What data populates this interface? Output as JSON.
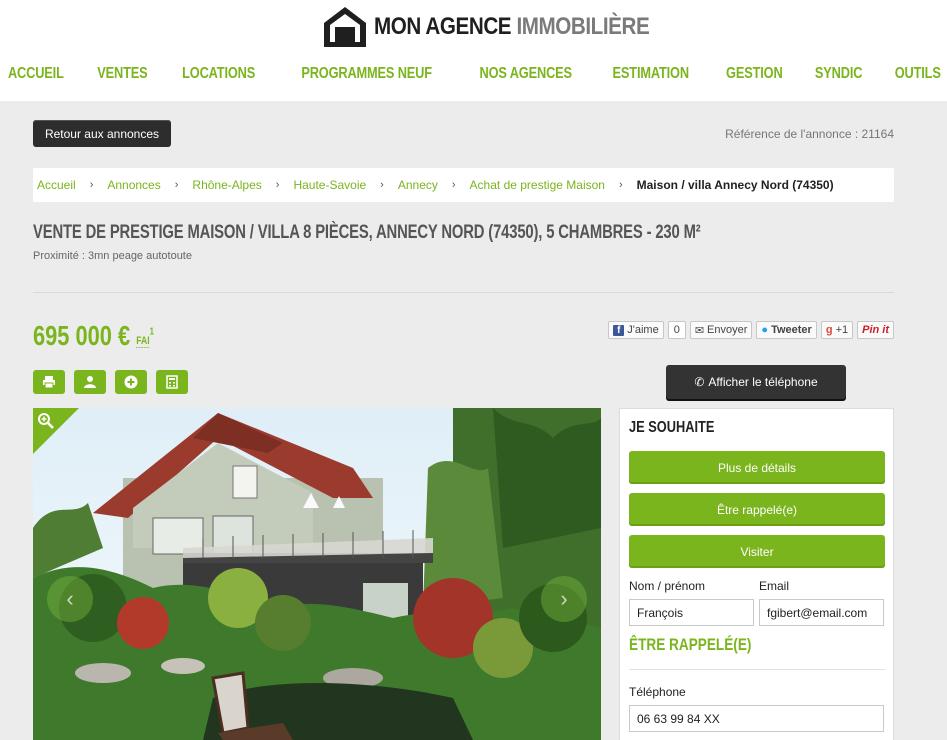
{
  "brand": {
    "name_part1": "MON AGENCE",
    "name_part2": "IMMOBILIÈRE",
    "accent_color": "#7ab51d"
  },
  "nav": [
    "ACCUEIL",
    "VENTES",
    "LOCATIONS",
    "PROGRAMMES NEUF",
    "NOS AGENCES",
    "ESTIMATION",
    "GESTION",
    "SYNDIC",
    "OUTILS"
  ],
  "top_bar": {
    "back_label": "Retour aux annonces",
    "reference": "Référence de l'annonce : 21164"
  },
  "breadcrumb": [
    "Accueil",
    "Annonces",
    "Rhône-Alpes",
    "Haute-Savoie",
    "Annecy",
    "Achat de prestige Maison"
  ],
  "breadcrumb_current": "Maison / villa Annecy Nord (74350)",
  "listing": {
    "title": "VENTE DE PRESTIGE MAISON / VILLA 8 PIÈCES, ANNECY NORD (74350), 5 CHAMBRES - 230 M²",
    "subtitle": "Proximité : 3mn peage autotoute",
    "price": "695 000 €",
    "price_suffix": "FAI",
    "price_note": "1"
  },
  "social": {
    "like": "J'aime",
    "like_count": "0",
    "send": "Envoyer",
    "tweet": "Tweeter",
    "gplus": "+1",
    "pinit": "Pin it"
  },
  "tools": [
    "print-icon",
    "user-icon",
    "add-icon",
    "calculator-icon"
  ],
  "phone_button": "Afficher le téléphone",
  "form": {
    "title": "JE SOUHAITE",
    "btn_details": "Plus de détails",
    "btn_callback": "Être rappelé(e)",
    "btn_visit": "Visiter",
    "name_label": "Nom / prénom",
    "name_value": "François",
    "email_label": "Email",
    "email_value": "fgibert@email.com",
    "section_title": "ÊTRE RAPPELÉ(E)",
    "phone_label": "Téléphone",
    "phone_value": "06 63 99 84 XX"
  }
}
